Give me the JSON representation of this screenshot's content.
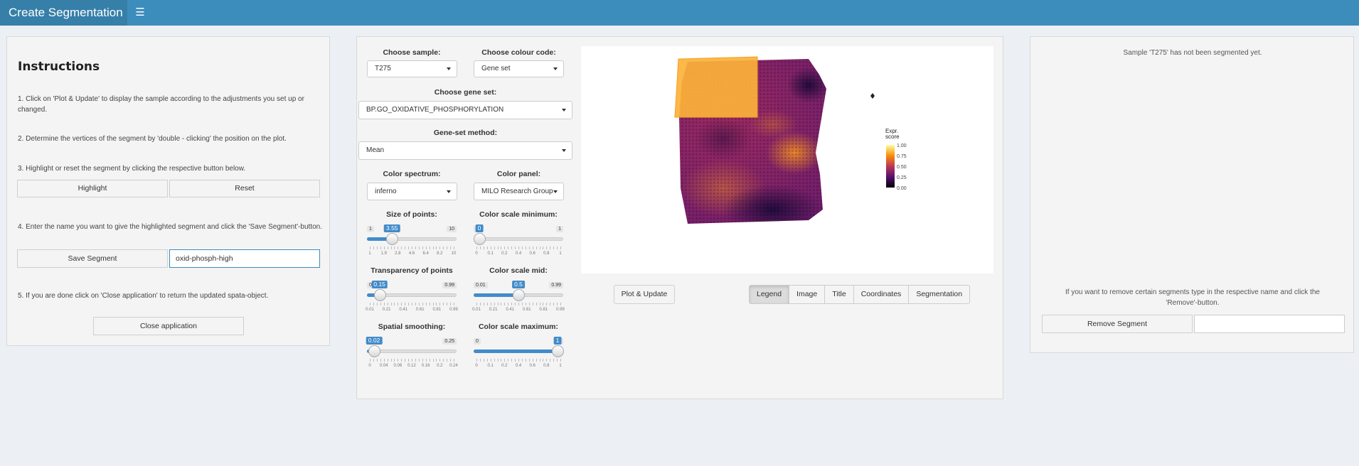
{
  "header": {
    "title": "Create Segmentation",
    "menu_icon": "hamburger-icon"
  },
  "instructions": {
    "title": "Instructions",
    "step1": "1. Click on 'Plot & Update' to display the sample according to the adjustments you set up or changed.",
    "step2": "2. Determine the vertices of the segment by 'double - clicking' the position on the plot.",
    "step3": "3. Highlight or reset the segment by clicking the respective button below.",
    "highlight_label": "Highlight",
    "reset_label": "Reset",
    "step4": "4. Enter the name you want to give the highlighted segment and click the 'Save Segment'-button.",
    "save_label": "Save Segment",
    "segment_name_value": "oxid-phosph-high",
    "step5": "5. If you are done click on 'Close application' to return the updated spata-object.",
    "close_label": "Close application"
  },
  "controls": {
    "sample": {
      "label": "Choose sample:",
      "value": "T275"
    },
    "colour_code": {
      "label": "Choose colour code:",
      "value": "Gene set"
    },
    "gene_set": {
      "label": "Choose gene set:",
      "value": "BP.GO_OXIDATIVE_PHOSPHORYLATION"
    },
    "gene_set_method": {
      "label": "Gene-set method:",
      "value": "Mean"
    },
    "color_spectrum": {
      "label": "Color spectrum:",
      "value": "inferno"
    },
    "color_panel": {
      "label": "Color panel:",
      "value": "MILO Research Group"
    },
    "size_of_points": {
      "label": "Size of points:",
      "min": "1",
      "max": "10",
      "value": "3.55",
      "fraction": 0.28,
      "ticks": [
        "1",
        "1.9",
        "2.8",
        "4.6",
        "6.4",
        "8.2",
        "10"
      ]
    },
    "transparency": {
      "label": "Transparency of points",
      "min": "0.01",
      "max": "0.99",
      "value": "0.15",
      "fraction": 0.14,
      "ticks": [
        "0.01",
        "0.21",
        "0.41",
        "0.61",
        "0.81",
        "0.99"
      ]
    },
    "spatial_smoothing": {
      "label": "Spatial smoothing:",
      "min": "0",
      "max": "0.25",
      "value": "0.02",
      "fraction": 0.08,
      "ticks": [
        "0",
        "0.04",
        "0.06",
        "0.12",
        "0.16",
        "0.2",
        "0.24"
      ]
    },
    "scale_minimum": {
      "label": "Color scale minimum:",
      "min": "0",
      "max": "1",
      "value": "0",
      "fraction": 0.0,
      "ticks": [
        "0",
        "0.1",
        "0.2",
        "0.4",
        "0.6",
        "0.8",
        "1"
      ]
    },
    "scale_mid": {
      "label": "Color scale mid:",
      "min": "0.01",
      "max": "0.99",
      "value": "0.5",
      "fraction": 0.5,
      "ticks": [
        "0.01",
        "0.21",
        "0.41",
        "0.61",
        "0.81",
        "0.99"
      ]
    },
    "scale_maximum": {
      "label": "Color scale maximum:",
      "min": "0",
      "max": "1",
      "value": "1",
      "fraction": 1.0,
      "ticks": [
        "0",
        "0.1",
        "0.2",
        "0.4",
        "0.6",
        "0.8",
        "1"
      ]
    }
  },
  "plot": {
    "legend_title_line1": "Expr.",
    "legend_title_line2": "score",
    "legend_ticks": [
      "1.00",
      "0.75",
      "0.50",
      "0.25",
      "0.00"
    ],
    "colors": {
      "dark": "#1d0a3c",
      "purple": "#6a1c6e",
      "magenta": "#9e2a63",
      "orange": "#f08a28",
      "yellow": "#fcc84a"
    }
  },
  "plot_update_label": "Plot & Update",
  "tabs": [
    {
      "label": "Legend",
      "active": true
    },
    {
      "label": "Image",
      "active": false
    },
    {
      "label": "Title",
      "active": false
    },
    {
      "label": "Coordinates",
      "active": false
    },
    {
      "label": "Segmentation",
      "active": false
    }
  ],
  "right_panel": {
    "status": "Sample 'T275' has not been segmented yet.",
    "remove_info": "If you want to remove certain segments type in the respective name and click the 'Remove'-button.",
    "remove_label": "Remove Segment",
    "remove_value": ""
  }
}
